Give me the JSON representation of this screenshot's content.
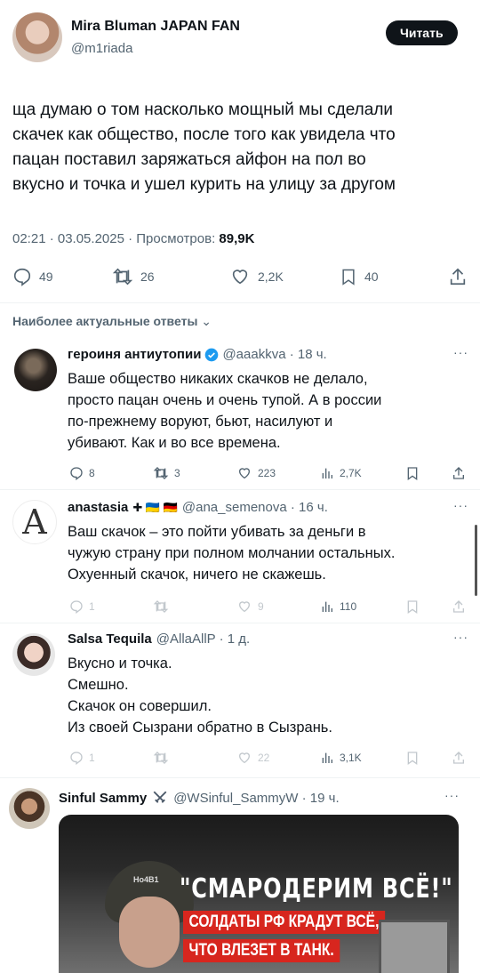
{
  "header": {
    "name": "Mira Bluman JAPAN FAN",
    "handle": "@m1riada",
    "follow_label": "Читать"
  },
  "tweet": {
    "text_lines": [
      "ща думаю о том насколько мощный мы сделали",
      "скачек как общество, после того как увидела что",
      "пацан поставил заряжаться айфон на пол во",
      "вкусно и точка и ушел курить на улицу за другом"
    ],
    "time_date": "02:21 · 03.05.2025 · Просмотров: ",
    "views": "89,9K",
    "stats": {
      "replies": "49",
      "retweets": "26",
      "likes": "2,2K",
      "bookmarks": "40"
    }
  },
  "replies_header": "Наиболее актуальные ответы",
  "replies": [
    {
      "name": "героиня антиутопии",
      "handle": "@aaakkva · 18 ч.",
      "text_lines": [
        "Ваше общество никаких скачков не делало,",
        "просто пацан очень и очень тупой. А в россии",
        "по-прежнему воруют, бьют, насилуют и",
        "убивают. Как и во все времена."
      ],
      "stats": {
        "replies": "8",
        "retweets": "3",
        "likes": "223",
        "views": "2,7K"
      }
    },
    {
      "name": "anastasia",
      "flags": "✚ 🇺🇦 🇩🇪",
      "handle": "@ana_semenova · 16 ч.",
      "text_lines": [
        "Ваш скачок – это пойти убивать за деньги в",
        "чужую страну при полном молчании остальных.",
        "Охуенный скачок, ничего не скажешь."
      ],
      "stats": {
        "replies": "1",
        "retweets": "",
        "likes": "9",
        "views": "110"
      }
    },
    {
      "name": "Salsa Tequila",
      "handle": "@AllaAllP · 1 д.",
      "text_lines": [
        "Вкусно и точка.",
        "Смешно.",
        "Скачок он совершил.",
        "Из своей Сызрани обратно в Сызрань."
      ],
      "stats": {
        "replies": "1",
        "retweets": "",
        "likes": "22",
        "views": "3,1K"
      }
    },
    {
      "name": "Sinful Sammy",
      "handle": "@WSinful_SammyW · 19 ч.",
      "image": {
        "headline": "\"СМАРОДЕРИМ ВСЁ!\"",
        "sub1": "СОЛДАТЫ РФ КРАДУТ ВСЁ,",
        "sub2": "ЧТО ВЛЕЗЕТ В ТАНК.",
        "helmet_text": "Ho4B1"
      }
    }
  ],
  "colors": {
    "accent": "#1d9bf0",
    "red": "#d7261e",
    "text": "#0f1419",
    "gray": "#536471"
  }
}
